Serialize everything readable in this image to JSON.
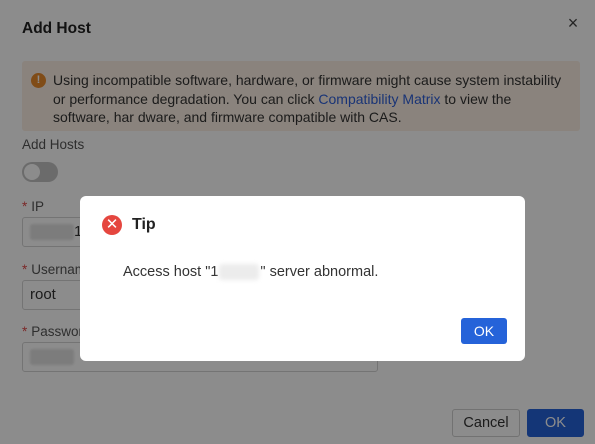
{
  "dialog": {
    "title": "Add Host",
    "close_glyph": "×",
    "warning": {
      "icon": "warning-icon",
      "text_before": "Using incompatible software, hardware, or firmware might cause system instability or performance degradation. You can click ",
      "link": "Compatibility Matrix",
      "text_after": " to view the software, har dware, and firmware compatible with CAS."
    },
    "add_hosts_label": "Add Hosts",
    "add_hosts_toggle": false,
    "fields": {
      "ip": {
        "label": "IP",
        "value_visible": "1"
      },
      "username": {
        "label": "Usernam",
        "value": "root"
      },
      "password": {
        "label": "Password"
      }
    },
    "cancel_label": "Cancel",
    "ok_label": "OK"
  },
  "tip": {
    "icon": "error-icon",
    "icon_glyph": "✕",
    "title": "Tip",
    "message_prefix": "Access host \"1",
    "message_suffix": "\" server abnormal.",
    "ok_label": "OK"
  },
  "colors": {
    "primary": "#2563d9",
    "warning_bg": "#fcefe3",
    "warning_icon": "#e98a2b",
    "error_icon": "#e5463f",
    "link": "#2f5fd7"
  }
}
